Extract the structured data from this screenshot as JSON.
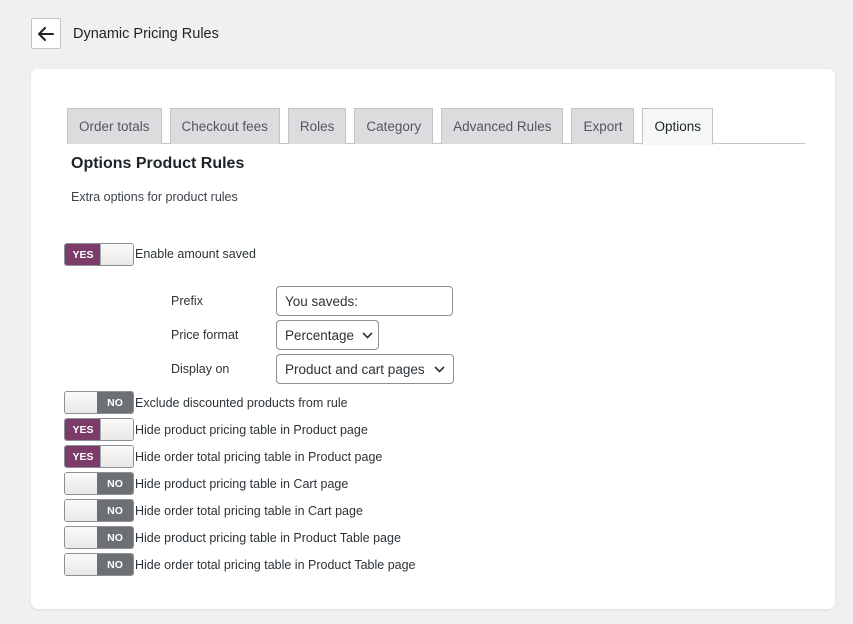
{
  "header": {
    "title": "Dynamic Pricing Rules"
  },
  "tabs": [
    {
      "label": "Order totals",
      "active": false
    },
    {
      "label": "Checkout fees",
      "active": false
    },
    {
      "label": "Roles",
      "active": false
    },
    {
      "label": "Category",
      "active": false
    },
    {
      "label": "Advanced Rules",
      "active": false
    },
    {
      "label": "Export",
      "active": false
    },
    {
      "label": "Options",
      "active": true
    }
  ],
  "section": {
    "title": "Options Product Rules",
    "description": "Extra options for product rules"
  },
  "enable_amount_saved": {
    "state": "YES",
    "label": "Enable amount saved"
  },
  "fields": {
    "prefix": {
      "label": "Prefix",
      "value": "You saveds:"
    },
    "price_format": {
      "label": "Price format",
      "value": "Percentage"
    },
    "display_on": {
      "label": "Display on",
      "value": "Product and cart pages"
    }
  },
  "options": [
    {
      "state": "NO",
      "label": "Exclude discounted products from rule"
    },
    {
      "state": "YES",
      "label": "Hide product pricing table in Product page"
    },
    {
      "state": "YES",
      "label": "Hide order total pricing table in Product page"
    },
    {
      "state": "NO",
      "label": "Hide product pricing table in Cart page"
    },
    {
      "state": "NO",
      "label": "Hide order total pricing table in Cart page"
    },
    {
      "state": "NO",
      "label": "Hide product pricing table in Product Table page"
    },
    {
      "state": "NO",
      "label": "Hide order total pricing table in Product Table page"
    }
  ],
  "colors": {
    "toggle_on": "#7b3c6a",
    "toggle_off": "#6c7074",
    "accent": "#7b3c6a"
  }
}
